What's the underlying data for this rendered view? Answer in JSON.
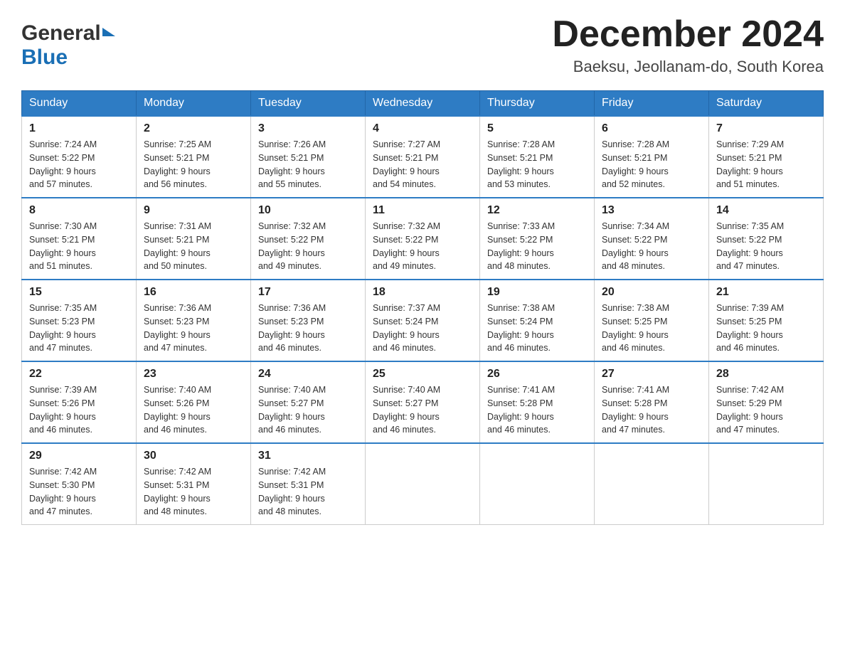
{
  "header": {
    "logo": {
      "general": "General",
      "blue": "Blue"
    },
    "title": "December 2024",
    "location": "Baeksu, Jeollanam-do, South Korea"
  },
  "days_of_week": [
    "Sunday",
    "Monday",
    "Tuesday",
    "Wednesday",
    "Thursday",
    "Friday",
    "Saturday"
  ],
  "weeks": [
    [
      {
        "day": "1",
        "sunrise": "7:24 AM",
        "sunset": "5:22 PM",
        "daylight": "9 hours and 57 minutes."
      },
      {
        "day": "2",
        "sunrise": "7:25 AM",
        "sunset": "5:21 PM",
        "daylight": "9 hours and 56 minutes."
      },
      {
        "day": "3",
        "sunrise": "7:26 AM",
        "sunset": "5:21 PM",
        "daylight": "9 hours and 55 minutes."
      },
      {
        "day": "4",
        "sunrise": "7:27 AM",
        "sunset": "5:21 PM",
        "daylight": "9 hours and 54 minutes."
      },
      {
        "day": "5",
        "sunrise": "7:28 AM",
        "sunset": "5:21 PM",
        "daylight": "9 hours and 53 minutes."
      },
      {
        "day": "6",
        "sunrise": "7:28 AM",
        "sunset": "5:21 PM",
        "daylight": "9 hours and 52 minutes."
      },
      {
        "day": "7",
        "sunrise": "7:29 AM",
        "sunset": "5:21 PM",
        "daylight": "9 hours and 51 minutes."
      }
    ],
    [
      {
        "day": "8",
        "sunrise": "7:30 AM",
        "sunset": "5:21 PM",
        "daylight": "9 hours and 51 minutes."
      },
      {
        "day": "9",
        "sunrise": "7:31 AM",
        "sunset": "5:21 PM",
        "daylight": "9 hours and 50 minutes."
      },
      {
        "day": "10",
        "sunrise": "7:32 AM",
        "sunset": "5:22 PM",
        "daylight": "9 hours and 49 minutes."
      },
      {
        "day": "11",
        "sunrise": "7:32 AM",
        "sunset": "5:22 PM",
        "daylight": "9 hours and 49 minutes."
      },
      {
        "day": "12",
        "sunrise": "7:33 AM",
        "sunset": "5:22 PM",
        "daylight": "9 hours and 48 minutes."
      },
      {
        "day": "13",
        "sunrise": "7:34 AM",
        "sunset": "5:22 PM",
        "daylight": "9 hours and 48 minutes."
      },
      {
        "day": "14",
        "sunrise": "7:35 AM",
        "sunset": "5:22 PM",
        "daylight": "9 hours and 47 minutes."
      }
    ],
    [
      {
        "day": "15",
        "sunrise": "7:35 AM",
        "sunset": "5:23 PM",
        "daylight": "9 hours and 47 minutes."
      },
      {
        "day": "16",
        "sunrise": "7:36 AM",
        "sunset": "5:23 PM",
        "daylight": "9 hours and 47 minutes."
      },
      {
        "day": "17",
        "sunrise": "7:36 AM",
        "sunset": "5:23 PM",
        "daylight": "9 hours and 46 minutes."
      },
      {
        "day": "18",
        "sunrise": "7:37 AM",
        "sunset": "5:24 PM",
        "daylight": "9 hours and 46 minutes."
      },
      {
        "day": "19",
        "sunrise": "7:38 AM",
        "sunset": "5:24 PM",
        "daylight": "9 hours and 46 minutes."
      },
      {
        "day": "20",
        "sunrise": "7:38 AM",
        "sunset": "5:25 PM",
        "daylight": "9 hours and 46 minutes."
      },
      {
        "day": "21",
        "sunrise": "7:39 AM",
        "sunset": "5:25 PM",
        "daylight": "9 hours and 46 minutes."
      }
    ],
    [
      {
        "day": "22",
        "sunrise": "7:39 AM",
        "sunset": "5:26 PM",
        "daylight": "9 hours and 46 minutes."
      },
      {
        "day": "23",
        "sunrise": "7:40 AM",
        "sunset": "5:26 PM",
        "daylight": "9 hours and 46 minutes."
      },
      {
        "day": "24",
        "sunrise": "7:40 AM",
        "sunset": "5:27 PM",
        "daylight": "9 hours and 46 minutes."
      },
      {
        "day": "25",
        "sunrise": "7:40 AM",
        "sunset": "5:27 PM",
        "daylight": "9 hours and 46 minutes."
      },
      {
        "day": "26",
        "sunrise": "7:41 AM",
        "sunset": "5:28 PM",
        "daylight": "9 hours and 46 minutes."
      },
      {
        "day": "27",
        "sunrise": "7:41 AM",
        "sunset": "5:28 PM",
        "daylight": "9 hours and 47 minutes."
      },
      {
        "day": "28",
        "sunrise": "7:42 AM",
        "sunset": "5:29 PM",
        "daylight": "9 hours and 47 minutes."
      }
    ],
    [
      {
        "day": "29",
        "sunrise": "7:42 AM",
        "sunset": "5:30 PM",
        "daylight": "9 hours and 47 minutes."
      },
      {
        "day": "30",
        "sunrise": "7:42 AM",
        "sunset": "5:31 PM",
        "daylight": "9 hours and 48 minutes."
      },
      {
        "day": "31",
        "sunrise": "7:42 AM",
        "sunset": "5:31 PM",
        "daylight": "9 hours and 48 minutes."
      },
      null,
      null,
      null,
      null
    ]
  ],
  "labels": {
    "sunrise": "Sunrise:",
    "sunset": "Sunset:",
    "daylight": "Daylight:"
  }
}
